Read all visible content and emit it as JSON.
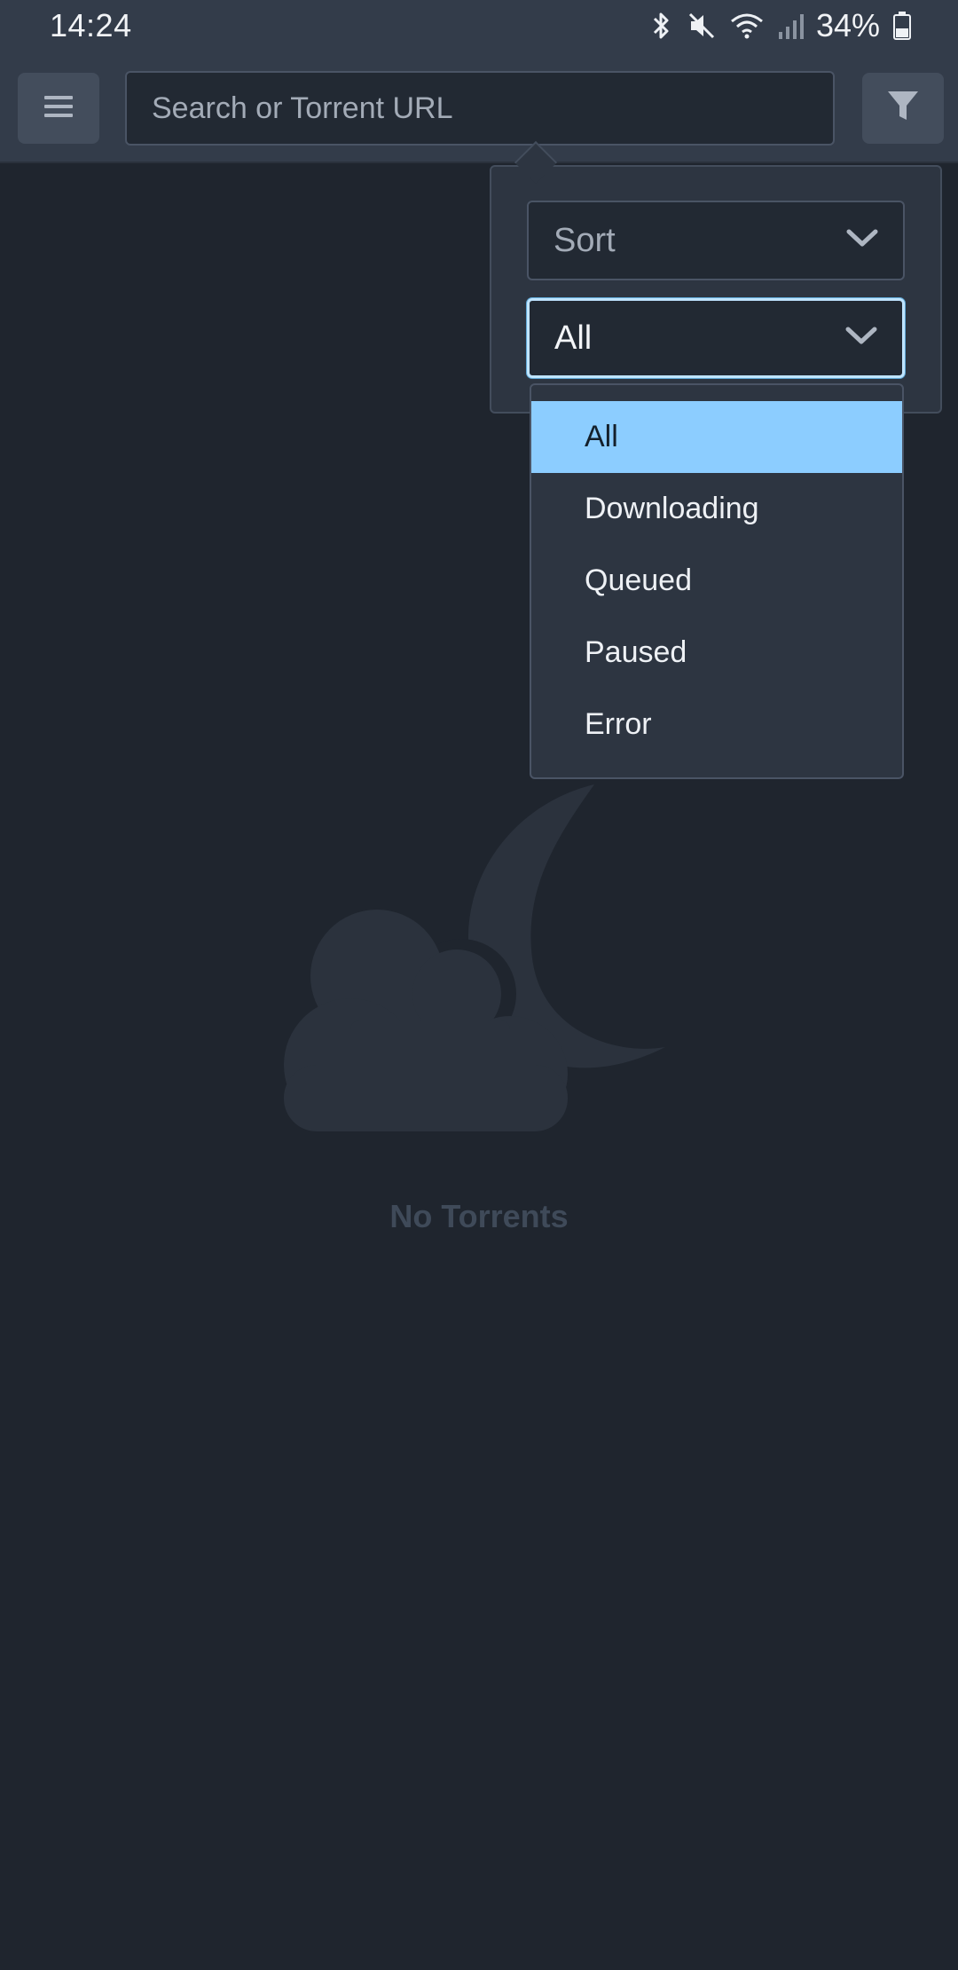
{
  "status_bar": {
    "time": "14:24",
    "battery": "34%",
    "icons": [
      "bluetooth-icon",
      "mute-icon",
      "wifi-icon",
      "signal-icon",
      "battery-icon"
    ]
  },
  "header": {
    "menu_icon": "hamburger-menu-icon",
    "search_placeholder": "Search or Torrent URL",
    "search_value": "",
    "filter_icon": "filter-funnel-icon"
  },
  "filter_popover": {
    "sort_select": {
      "label": "Sort",
      "icon": "chevron-down-icon"
    },
    "status_select": {
      "value": "All",
      "icon": "chevron-down-icon"
    },
    "options": [
      {
        "label": "All",
        "selected": true
      },
      {
        "label": "Downloading",
        "selected": false
      },
      {
        "label": "Queued",
        "selected": false
      },
      {
        "label": "Paused",
        "selected": false
      },
      {
        "label": "Error",
        "selected": false
      }
    ]
  },
  "empty_state": {
    "icon": "cloud-moon-icon",
    "message": "No Torrents"
  },
  "colors": {
    "background": "#1f252e",
    "bar": "#333c4a",
    "selected_option": "#8ccdff",
    "focus_border": "#bfe4ff"
  }
}
